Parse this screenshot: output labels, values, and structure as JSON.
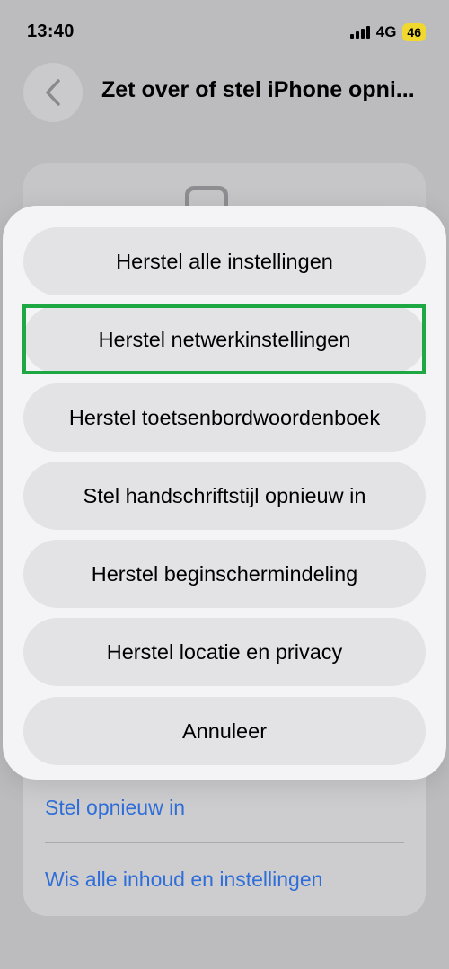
{
  "status_bar": {
    "time": "13:40",
    "network": "4G",
    "battery": "46"
  },
  "nav": {
    "back_icon": "chevron-left-icon",
    "title": "Zet over of stel iPhone opni..."
  },
  "background": {
    "links": [
      "Stel opnieuw in",
      "Wis alle inhoud en instellingen"
    ],
    "link_color": "#2f6ed8"
  },
  "action_sheet": {
    "options": [
      "Herstel alle instellingen",
      "Herstel netwerkinstellingen",
      "Herstel toetsenbordwoordenboek",
      "Stel handschriftstijl opnieuw in",
      "Herstel beginschermindeling",
      "Herstel locatie en privacy"
    ],
    "cancel": "Annuleer",
    "highlighted_option": "Herstel netwerkinstellingen",
    "highlight_color": "#1ea844"
  }
}
